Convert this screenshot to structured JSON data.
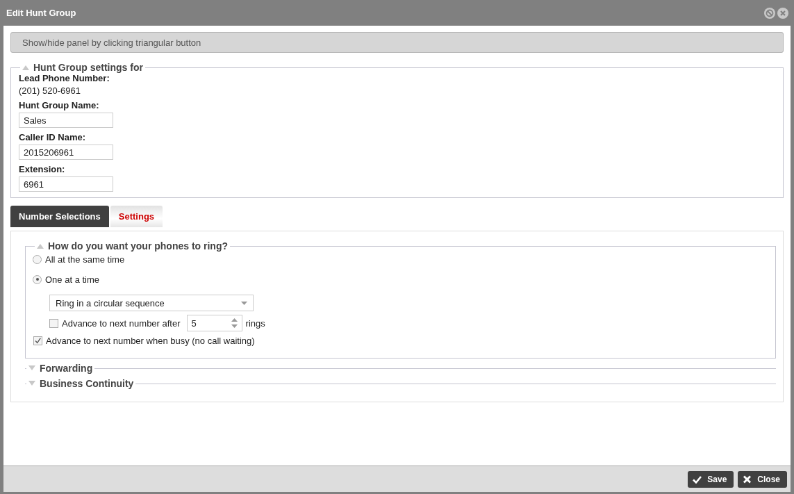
{
  "window": {
    "title": "Edit Hunt Group"
  },
  "info_bar": {
    "text": "Show/hide panel by clicking triangular button"
  },
  "settings_panel": {
    "title": "Hunt Group settings for",
    "expanded": true,
    "fields": [
      {
        "kind": "static",
        "label": "Lead Phone Number:",
        "value": "(201) 520-6961"
      },
      {
        "kind": "input",
        "label": "Hunt Group Name:",
        "value": "Sales"
      },
      {
        "kind": "input",
        "label": "Caller ID Name:",
        "value": "2015206961"
      },
      {
        "kind": "input",
        "label": "Extension:",
        "value": "6961"
      }
    ]
  },
  "tabs": [
    {
      "label": "Number Selections",
      "selected": false
    },
    {
      "label": "Settings",
      "selected": true
    }
  ],
  "sections": [
    {
      "title": "How do you want your phones to ring?",
      "expanded": true,
      "options": [
        {
          "kind": "radio",
          "label": "All at the same time",
          "selected": false
        },
        {
          "kind": "radio",
          "label": "One at a time",
          "selected": true
        },
        {
          "kind": "dropdown",
          "value": "Ring in a circular sequence"
        },
        {
          "kind": "spin-checkbox",
          "label": "Advance to next number after",
          "checked": false,
          "value": "5",
          "suffix": "rings"
        },
        {
          "kind": "checkbox",
          "label": "Advance to next number when busy (no call waiting)",
          "checked": true
        }
      ]
    },
    {
      "title": "Forwarding",
      "expanded": false
    },
    {
      "title": "Business Continuity",
      "expanded": false
    }
  ],
  "buttons": [
    {
      "kind": "save",
      "label": "Save"
    },
    {
      "kind": "close",
      "label": "Close"
    }
  ]
}
